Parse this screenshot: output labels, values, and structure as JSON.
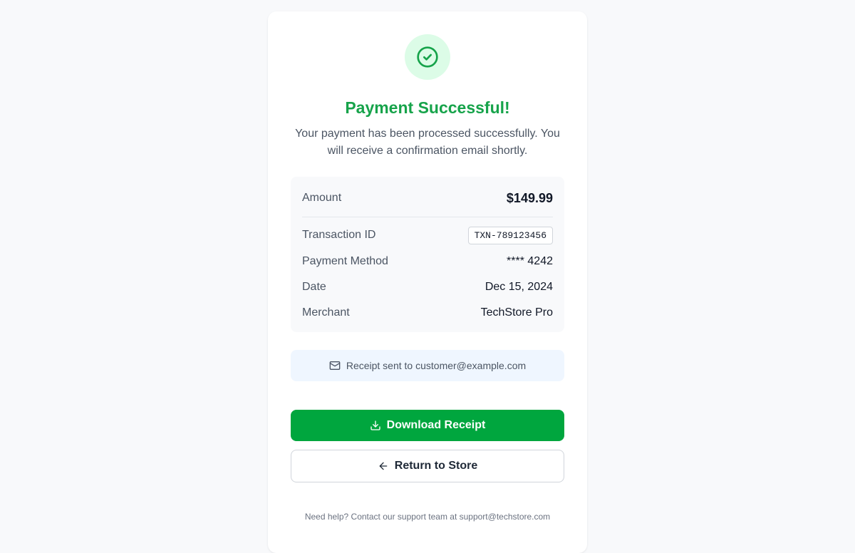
{
  "status": {
    "icon": "check-circle-icon",
    "title": "Payment Successful!",
    "message": "Your payment has been processed successfully. You will receive a confirmation email shortly."
  },
  "details": {
    "amount_label": "Amount",
    "amount_value": "$149.99",
    "transaction_label": "Transaction ID",
    "transaction_value": "TXN-789123456",
    "method_label": "Payment Method",
    "method_value": "**** 4242",
    "date_label": "Date",
    "date_value": "Dec 15, 2024",
    "merchant_label": "Merchant",
    "merchant_value": "TechStore Pro"
  },
  "receipt_note": {
    "icon": "mail-icon",
    "text": "Receipt sent to customer@example.com"
  },
  "actions": {
    "download_icon": "download-icon",
    "download_label": "Download Receipt",
    "return_icon": "arrow-left-icon",
    "return_label": "Return to Store"
  },
  "footer": {
    "help_text": "Need help? Contact our support team at support@techstore.com"
  },
  "colors": {
    "success": "#16a34a",
    "success_bg": "#dcfce7",
    "primary_button": "#00a63e",
    "note_bg": "#eff6ff"
  }
}
